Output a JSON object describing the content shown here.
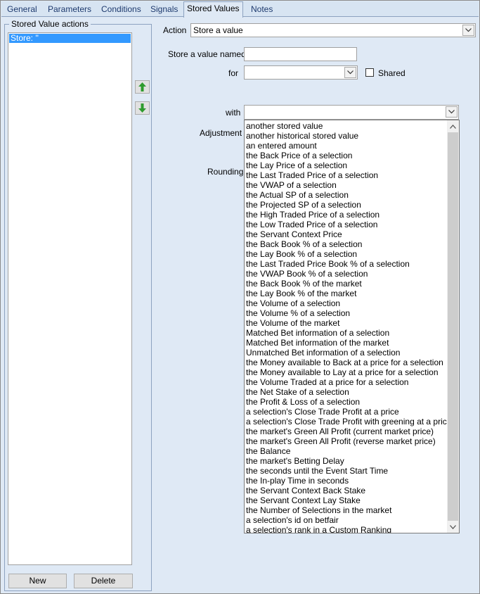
{
  "tabs": [
    {
      "label": "General"
    },
    {
      "label": "Parameters"
    },
    {
      "label": "Conditions"
    },
    {
      "label": "Signals"
    },
    {
      "label": "Stored Values"
    },
    {
      "label": "Notes"
    }
  ],
  "active_tab": "Stored Values",
  "left_panel": {
    "title": "Stored Value actions",
    "items": [
      "Store: ''"
    ],
    "new_label": "New",
    "delete_label": "Delete",
    "move_up_icon": "green-up-arrow-icon",
    "move_down_icon": "green-down-arrow-icon"
  },
  "form": {
    "action_label": "Action",
    "action_value": "Store a value",
    "store_named_label": "Store a value named",
    "store_named_value": "",
    "for_label": "for",
    "for_value": "",
    "shared_label": "Shared",
    "shared_checked": false,
    "with_label": "with",
    "with_value": "",
    "adjustment_label": "Adjustment",
    "rounding_label": "Rounding"
  },
  "with_options": [
    "another stored value",
    "another historical stored value",
    "an entered amount",
    "the Back Price of a selection",
    "the Lay Price of a selection",
    "the Last Traded Price of a selection",
    "the VWAP of a selection",
    "the Actual SP of a selection",
    "the Projected SP of a selection",
    "the High Traded Price of a selection",
    "the Low Traded Price of a selection",
    "the Servant Context Price",
    "the Back Book % of a selection",
    "the Lay Book % of a selection",
    "the Last Traded Price Book % of a selection",
    "the VWAP Book % of a selection",
    "the Back Book % of the market",
    "the Lay Book % of the market",
    "the Volume of a selection",
    "the Volume % of a selection",
    "the Volume of the market",
    "Matched Bet information of a selection",
    "Matched Bet information of the market",
    "Unmatched Bet information of a selection",
    "the Money available to Back at a price for a selection",
    "the Money available to Lay at a price for a selection",
    "the Volume Traded at a price for a selection",
    "the Net Stake of a selection",
    "the Profit & Loss of a selection",
    "a selection's Close Trade Profit at a price",
    "a selection's Close Trade Profit with greening at a price",
    "the market's Green All Profit (current market price)",
    "the market's Green All Profit (reverse market price)",
    "the Balance",
    "the market's Betting Delay",
    "the seconds until the Event Start Time",
    "the In-play Time in seconds",
    "the Servant Context Back Stake",
    "the Servant Context Lay Stake",
    "the Number of Selections in the market",
    "a selection's id on betfair",
    "a selection's rank in a Custom Ranking"
  ],
  "colors": {
    "window_bg": "#dfe9f5",
    "selection": "#3399ff",
    "arrow_green": "#2e9b2e"
  }
}
